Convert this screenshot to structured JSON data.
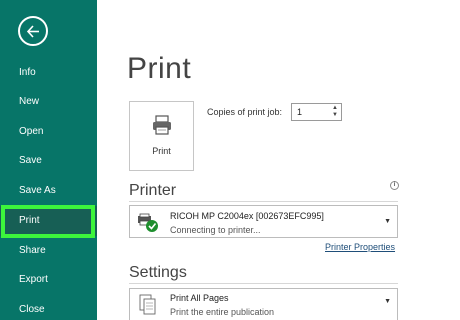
{
  "sidebar": {
    "items": [
      {
        "label": "Info"
      },
      {
        "label": "New"
      },
      {
        "label": "Open"
      },
      {
        "label": "Save"
      },
      {
        "label": "Save As"
      },
      {
        "label": "Print"
      },
      {
        "label": "Share"
      },
      {
        "label": "Export"
      },
      {
        "label": "Close"
      }
    ],
    "active": "Print",
    "color": "#077568",
    "highlight_color": "#3cf53c"
  },
  "main": {
    "title": "Print",
    "print_button_label": "Print",
    "copies": {
      "label": "Copies of print job:",
      "value": "1"
    },
    "printer": {
      "section_title": "Printer",
      "name": "RICOH MP C2004ex [002673EFC995]",
      "status": "Connecting to printer...",
      "properties_link": "Printer Properties"
    },
    "settings": {
      "section_title": "Settings",
      "pages_option": "Print All Pages",
      "pages_desc": "Print the entire publication"
    }
  },
  "icons": [
    "back-arrow-icon",
    "printer-icon",
    "info-icon",
    "printer-status-icon",
    "pages-icon",
    "chevron-down-icon"
  ]
}
